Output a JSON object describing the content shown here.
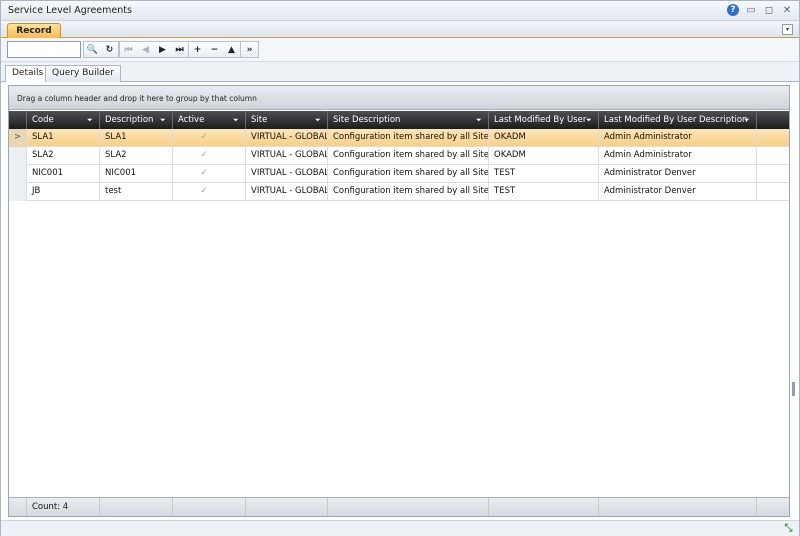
{
  "window": {
    "title": "Service Level Agreements",
    "help_glyph": "?",
    "minimize_glyph": "▭",
    "restore_glyph": "◻",
    "close_glyph": "✕"
  },
  "ribbon": {
    "tab_label": "Record",
    "menu_glyph": "▾"
  },
  "toolbar": {
    "search_value": "",
    "search_placeholder": "",
    "search_glyph": "🔍",
    "refresh_glyph": "↻",
    "first_glyph": "⏮",
    "prev_glyph": "◀",
    "next_glyph": "▶",
    "last_glyph": "⏭",
    "add_glyph": "+",
    "remove_glyph": "−",
    "up_glyph": "▲",
    "more_glyph": "»"
  },
  "tabs": [
    {
      "label": "Details",
      "active": true
    },
    {
      "label": "Query Builder",
      "active": false
    }
  ],
  "grid": {
    "group_panel_text": "Drag a column header and drop it here to group by that column",
    "columns": [
      "Code",
      "Description",
      "Active",
      "Site",
      "Site Description",
      "Last Modified By User",
      "Last Modified By User Description"
    ],
    "filter_glyph": "⏷",
    "row_indicator_glyph": ">",
    "check_glyph": "✓",
    "rows": [
      {
        "code": "SLA1",
        "description": "SLA1",
        "active": true,
        "site": "VIRTUAL - GLOBAL",
        "site_description": "Configuration item shared by all Sites.",
        "modified_by": "OKADM",
        "modified_by_description": "Admin Administrator",
        "selected": true
      },
      {
        "code": "SLA2",
        "description": "SLA2",
        "active": true,
        "site": "VIRTUAL - GLOBAL",
        "site_description": "Configuration item shared by all Sites.",
        "modified_by": "OKADM",
        "modified_by_description": "Admin Administrator",
        "selected": false
      },
      {
        "code": "NIC001",
        "description": "NIC001",
        "active": true,
        "site": "VIRTUAL - GLOBAL",
        "site_description": "Configuration item shared by all Sites.",
        "modified_by": "TEST",
        "modified_by_description": "Administrator Denver",
        "selected": false
      },
      {
        "code": "JB",
        "description": "test",
        "active": true,
        "site": "VIRTUAL - GLOBAL",
        "site_description": "Configuration item shared by all Sites.",
        "modified_by": "TEST",
        "modified_by_description": "Administrator Denver",
        "selected": false
      }
    ],
    "footer_count": "Count: 4"
  },
  "statusbar": {
    "resize_glyph": "⤡"
  }
}
